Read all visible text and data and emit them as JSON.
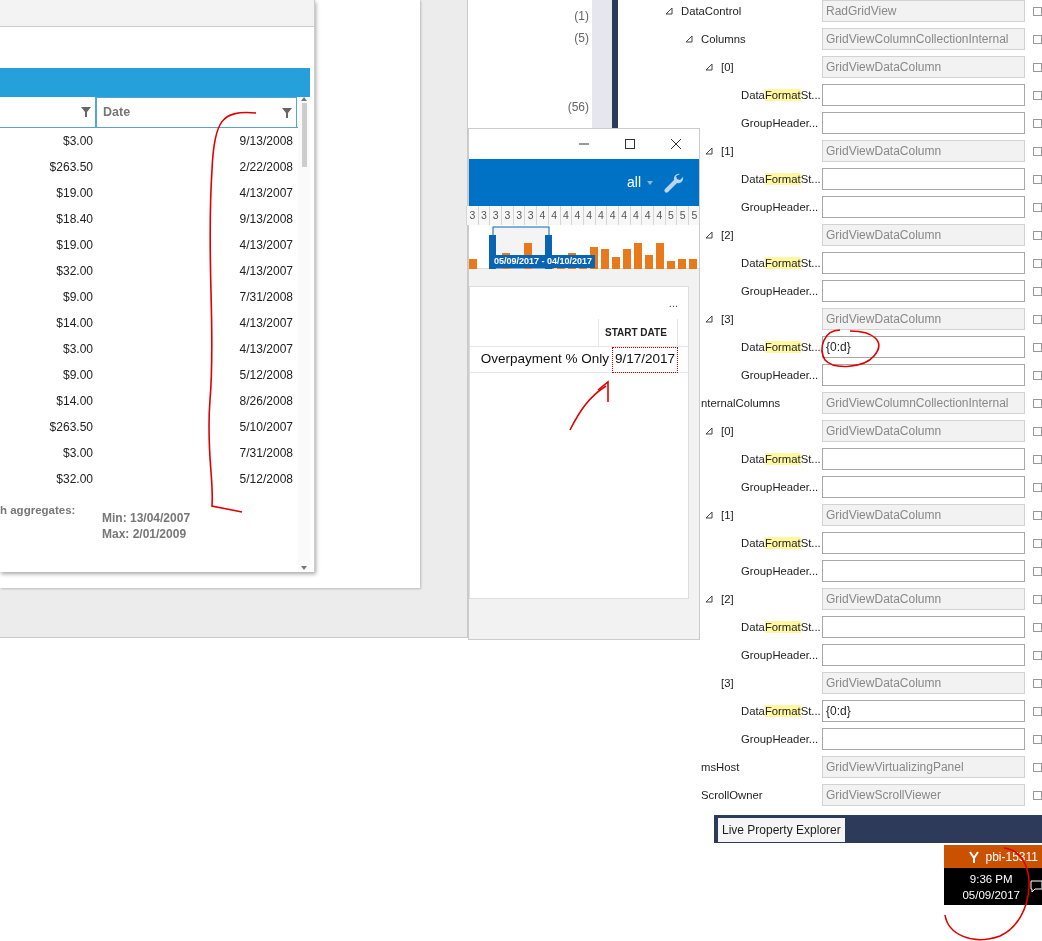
{
  "grid_window": {
    "columns": [
      {
        "filter": true
      },
      {
        "label": "Date",
        "filter": true
      }
    ],
    "rows": [
      [
        "$3.00",
        "9/13/2008"
      ],
      [
        "$263.50",
        "2/22/2008"
      ],
      [
        "$19.00",
        "4/13/2007"
      ],
      [
        "$18.40",
        "9/13/2008"
      ],
      [
        "$19.00",
        "4/13/2007"
      ],
      [
        "$32.00",
        "4/13/2007"
      ],
      [
        "$9.00",
        "7/31/2008"
      ],
      [
        "$14.00",
        "4/13/2007"
      ],
      [
        "$3.00",
        "4/13/2007"
      ],
      [
        "$9.00",
        "5/12/2008"
      ],
      [
        "$14.00",
        "8/26/2008"
      ],
      [
        "$263.50",
        "5/10/2007"
      ],
      [
        "$3.00",
        "7/31/2008"
      ],
      [
        "$32.00",
        "5/12/2008"
      ]
    ],
    "aggregates_label": "h aggregates:",
    "aggregates": [
      "Min: 13/04/2007",
      "Max: 2/01/2009"
    ]
  },
  "background_counts": [
    "(1)",
    "(5)",
    "(56)"
  ],
  "app_window": {
    "filter": "all",
    "timeline_ticks": [
      "3",
      "3",
      "3",
      "3",
      "3",
      "3",
      "4",
      "4",
      "4",
      "4",
      "4",
      "4",
      "4",
      "4",
      "4",
      "4",
      "4",
      "5",
      "5",
      "5"
    ],
    "range_label": "05/09/2017 - 04/10/2017",
    "more": "...",
    "table": {
      "columns": [
        "",
        "START DATE"
      ],
      "rows": [
        {
          "cells": [
            {
              "text": "Overpayment % Only",
              "selected": false
            },
            {
              "text": "9/17/2017",
              "selected": true
            }
          ]
        }
      ]
    }
  },
  "property_explorer": {
    "items": [
      {
        "name": "DataControl",
        "value": "RadGridView",
        "editable": false,
        "expanded": true,
        "children": [
          {
            "name": "Columns",
            "value": "GridViewColumnCollectionInternal",
            "editable": false,
            "expanded": true,
            "children": [
              {
                "name": "[0]",
                "value": "GridViewDataColumn",
                "editable": false,
                "expanded": true,
                "children": [
                  {
                    "name": "Data**Format**St...",
                    "editable": true
                  },
                  {
                    "name": "GroupHeader...",
                    "editable": true
                  }
                ]
              },
              {
                "name": "[1]",
                "value": "GridViewDataColumn",
                "editable": false,
                "expanded": true,
                "children": [
                  {
                    "name": "Data**Format**St...",
                    "editable": true
                  },
                  {
                    "name": "GroupHeader...",
                    "editable": true
                  }
                ]
              },
              {
                "name": "[2]",
                "value": "GridViewDataColumn",
                "editable": false,
                "expanded": true,
                "children": [
                  {
                    "name": "Data**Format**St...",
                    "editable": true
                  },
                  {
                    "name": "GroupHeader...",
                    "editable": true
                  }
                ]
              },
              {
                "name": "[3]",
                "value": "GridViewDataColumn",
                "editable": false,
                "expanded": true,
                "children": [
                  {
                    "name": "Data**Format**St...",
                    "value": "{0:d}",
                    "editable": true
                  },
                  {
                    "name": "GroupHeader...",
                    "editable": true
                  }
                ]
              }
            ]
          },
          {
            "name": "nternalColumns",
            "value": "GridViewColumnCollectionInternal",
            "editable": false,
            "children": [
              {
                "name": "[0]",
                "value": "GridViewDataColumn",
                "editable": false,
                "expanded": true,
                "children": [
                  {
                    "name": "Data**Format**St...",
                    "editable": true
                  },
                  {
                    "name": "GroupHeader...",
                    "editable": true
                  }
                ]
              },
              {
                "name": "[1]",
                "value": "GridViewDataColumn",
                "editable": false,
                "expanded": true,
                "children": [
                  {
                    "name": "Data**Format**St...",
                    "editable": true
                  },
                  {
                    "name": "GroupHeader...",
                    "editable": true
                  }
                ]
              },
              {
                "name": "[2]",
                "value": "GridViewDataColumn",
                "editable": false,
                "expanded": true,
                "children": [
                  {
                    "name": "Data**Format**St...",
                    "editable": true
                  },
                  {
                    "name": "GroupHeader...",
                    "editable": true
                  }
                ]
              },
              {
                "name": "[3]",
                "value": "GridViewDataColumn",
                "editable": false,
                "children": [
                  {
                    "name": "Data**Format**St...",
                    "value": "{0:d}",
                    "editable": true
                  },
                  {
                    "name": "GroupHeader...",
                    "editable": true
                  }
                ]
              }
            ]
          },
          {
            "name": "msHost",
            "value": "GridViewVirtualizingPanel",
            "editable": false
          },
          {
            "name": "ScrollOwner",
            "value": "GridViewScrollViewer",
            "editable": false
          }
        ]
      }
    ],
    "tab": "Live Property Explorer"
  },
  "taskbar": {
    "branch": "pbi-15311",
    "time": "9:36 PM",
    "date": "05/09/2017"
  }
}
